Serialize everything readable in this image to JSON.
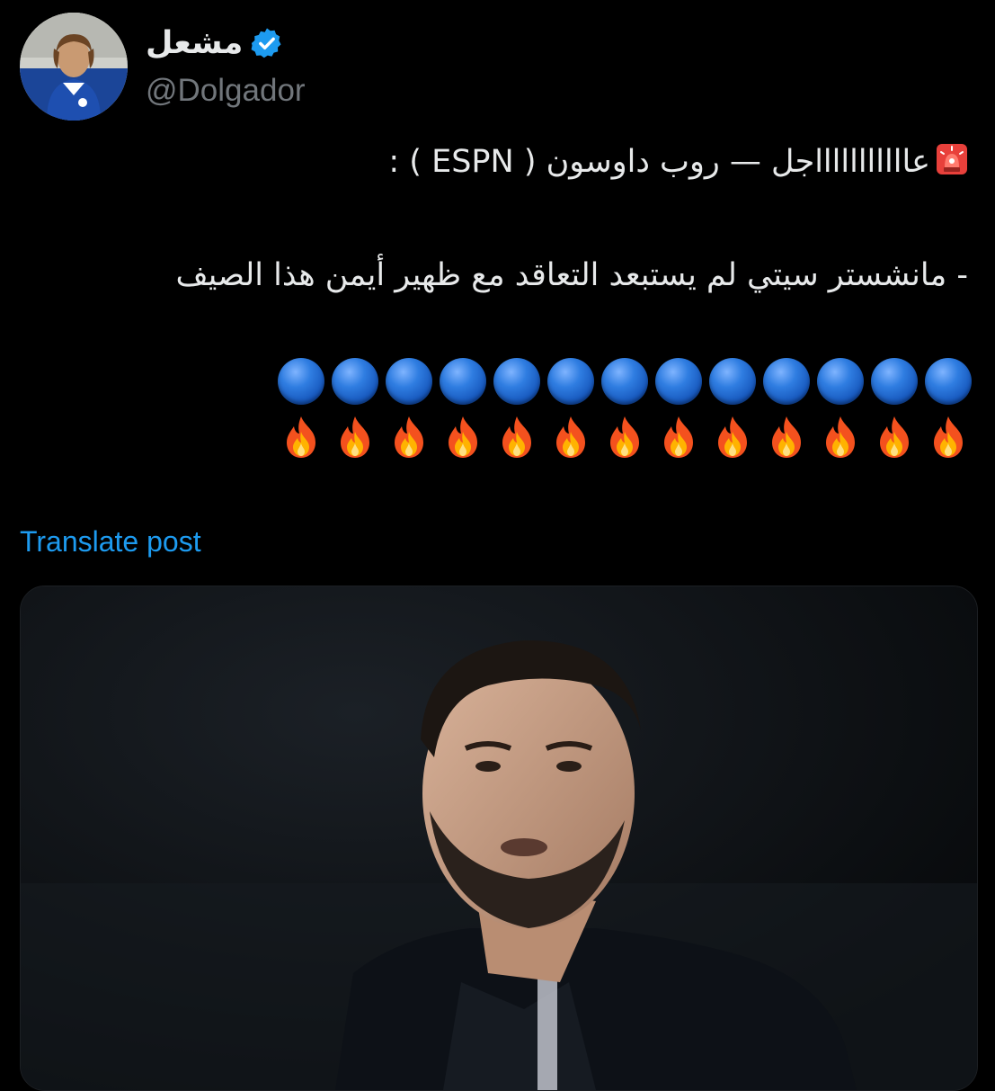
{
  "author": {
    "display_name": "مشعل",
    "handle": "@Dolgador",
    "verified_icon": "verified-badge-icon",
    "accent_color": "#1d9bf0"
  },
  "tweet": {
    "line1": "عاااااااااااجل — روب داوسون ( ESPN ) :",
    "line2": "- مانشستر سيتي لم يستبعد التعاقد مع ظهير أيمن هذا الصيف",
    "alert_icon": "rotating-light-icon",
    "blue_circles_count": 13,
    "fire_count": 13
  },
  "translate": {
    "label": "Translate post"
  },
  "media": {
    "alt_icon": "photo-icon"
  }
}
